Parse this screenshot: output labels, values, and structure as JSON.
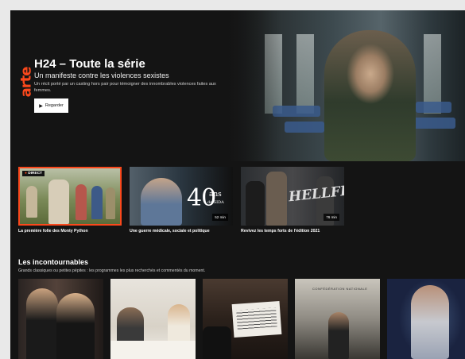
{
  "hero": {
    "logo": "arte",
    "title": "H24 – Toute la série",
    "subtitle": "Un manifeste contre les violences sexistes",
    "description": "Un récit porté par un casting hors pair pour témoigner des innombrables violences faites aux femmes.",
    "watch_label": "Regarder"
  },
  "featured": [
    {
      "badge": "DIRECT",
      "caption": "La première folie des Monty Python"
    },
    {
      "overlay_big": "40",
      "overlay_small": "ans",
      "overlay_sub": "de SIDA",
      "duration": "52 min",
      "caption": "Une guerre médicale, sociale et politique"
    },
    {
      "overlay_big": "HELLFEST",
      "duration": "76 min",
      "caption": "Revivez les temps forts de l'édition 2021"
    }
  ],
  "section": {
    "title": "Les incontournables",
    "description": "Grands classiques ou petites pépites : les programmes les plus recherchés et commentés du moment."
  },
  "cards": [
    {
      "overlay": ""
    },
    {
      "overlay": ""
    },
    {
      "overlay": ""
    },
    {
      "overlay": "CONFÉDÉRATION NATIONALE"
    },
    {
      "overlay": ""
    }
  ]
}
